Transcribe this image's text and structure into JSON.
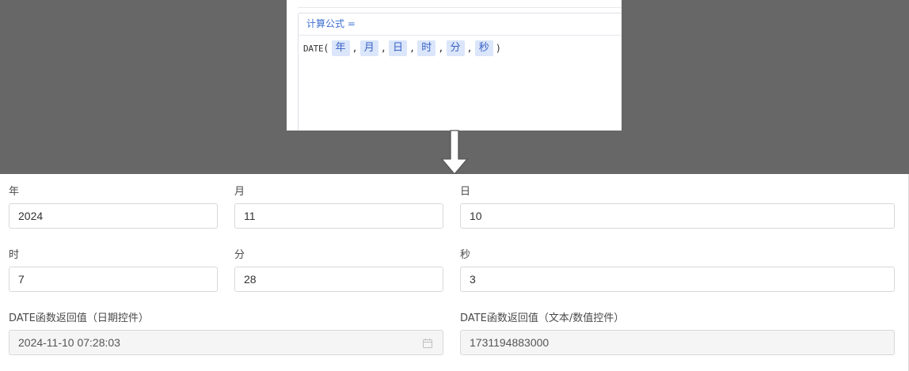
{
  "formula": {
    "header": "计算公式 =",
    "function_name": "DATE",
    "open_paren": "(",
    "close_paren": ")",
    "separator": ",",
    "tokens": [
      "年",
      "月",
      "日",
      "时",
      "分",
      "秒"
    ]
  },
  "fields": {
    "year": {
      "label": "年",
      "value": "2024"
    },
    "month": {
      "label": "月",
      "value": "11"
    },
    "day": {
      "label": "日",
      "value": "10"
    },
    "hour": {
      "label": "时",
      "value": "7"
    },
    "minute": {
      "label": "分",
      "value": "28"
    },
    "second": {
      "label": "秒",
      "value": "3"
    },
    "date_result": {
      "label": "DATE函数返回值（日期控件）",
      "value": "2024-11-10 07:28:03"
    },
    "text_result": {
      "label": "DATE函数返回值（文本/数值控件）",
      "value": "1731194883000"
    }
  },
  "icons": {
    "arrow": "down-arrow-icon",
    "calendar": "calendar-icon"
  },
  "colors": {
    "background_band": "#676767",
    "accent": "#3d6fd1",
    "token_bg": "#dbe6fb"
  }
}
